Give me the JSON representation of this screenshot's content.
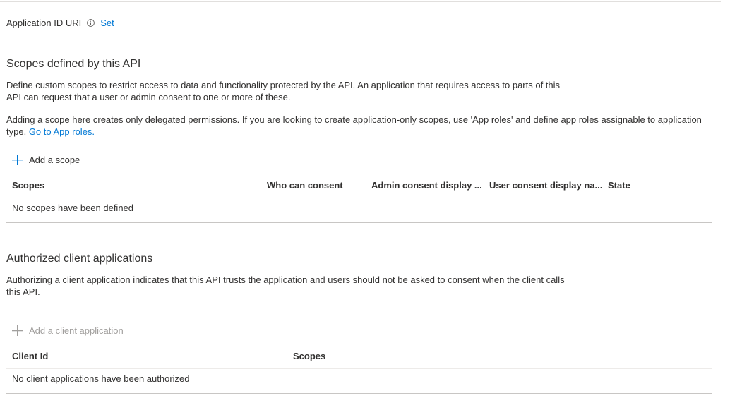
{
  "app_id_uri": {
    "label": "Application ID URI",
    "info_icon": "info-icon",
    "set_link": "Set"
  },
  "scopes_section": {
    "title": "Scopes defined by this API",
    "description_line1": "Define custom scopes to restrict access to data and functionality protected by the API. An application that requires access to parts of this",
    "description_line2": "API can request that a user or admin consent to one or more of these.",
    "note_line1": "Adding a scope here creates only delegated permissions. If you are looking to create application-only scopes, use 'App roles' and define app roles assignable to application",
    "note_line2_prefix": "type.",
    "note_link": "Go to App roles.",
    "add_button": "Add a scope",
    "add_icon": "plus-icon",
    "columns": [
      "Scopes",
      "Who can consent",
      "Admin consent display ...",
      "User consent display na...",
      "State"
    ],
    "empty_message": "No scopes have been defined"
  },
  "clients_section": {
    "title": "Authorized client applications",
    "description_line1": "Authorizing a client application indicates that this API trusts the application and users should not be asked to consent when the client calls",
    "description_line2": "this API.",
    "add_button": "Add a client application",
    "add_icon": "plus-icon",
    "columns": [
      "Client Id",
      "Scopes"
    ],
    "empty_message": "No client applications have been authorized"
  },
  "colors": {
    "link": "#0078d4",
    "text": "#323130",
    "disabled": "#a19f9d",
    "divider": "#e1dfdd"
  }
}
